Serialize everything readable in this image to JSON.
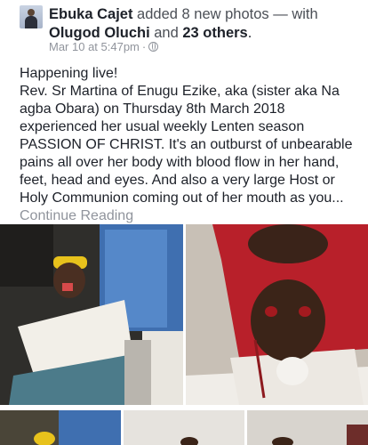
{
  "post": {
    "author": "Ebuka Cajet",
    "action": " added 8 new photos — with",
    "tagged_name": "Olugod Oluchi",
    "conjunction": " and ",
    "others": "23 others",
    "period": ".",
    "timestamp": "Mar 10 at 5:47pm",
    "separator": " · ",
    "privacy_icon": "globe-icon",
    "body": "Happening live!\nRev. Sr Martina of Enugu Ezike, aka (sister aka Na agba Obara) on Thursday 8th March 2018 experienced her usual weekly  Lenten season PASSION OF CHRIST. It's an outburst of unbearable pains all over her body with blood flow in her hand, feet, head and eyes. And also a very large Host or Holy Communion coming out of her mouth as you...",
    "continue_label": "Continue Reading"
  },
  "photos": {
    "count": 5
  }
}
